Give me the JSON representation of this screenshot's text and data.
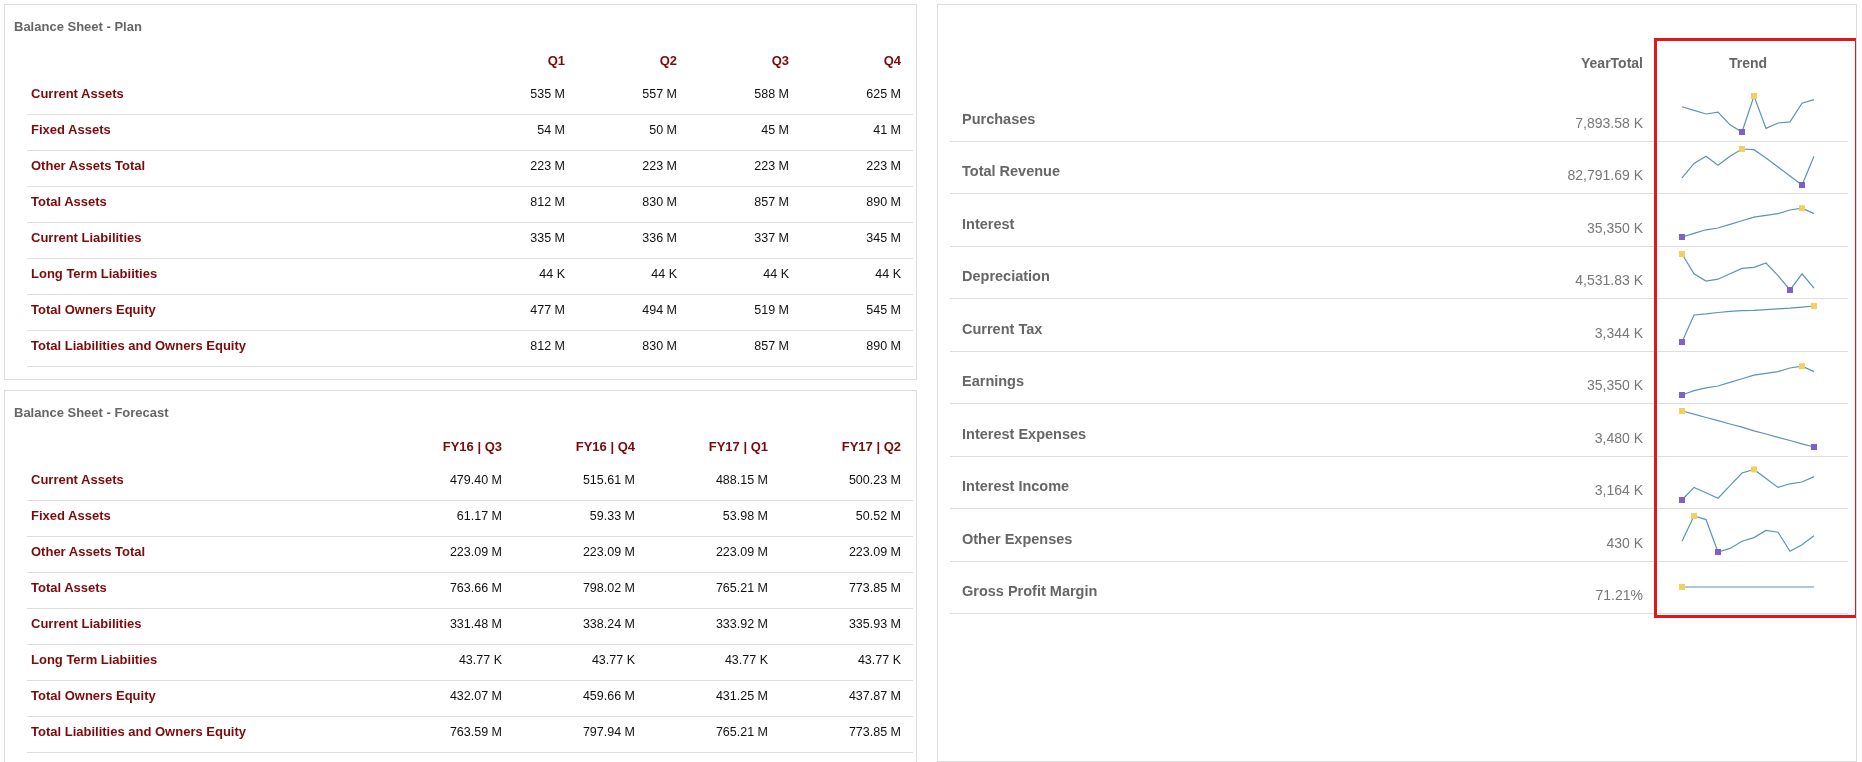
{
  "balance_sheets": [
    {
      "title": "Balance Sheet - Plan",
      "columns": [
        "Q1",
        "Q2",
        "Q3",
        "Q4"
      ],
      "rows": [
        {
          "label": "Current Assets",
          "values": [
            "535 M",
            "557 M",
            "588 M",
            "625 M"
          ]
        },
        {
          "label": "Fixed Assets",
          "values": [
            "54 M",
            "50 M",
            "45 M",
            "41 M"
          ]
        },
        {
          "label": "Other Assets Total",
          "values": [
            "223 M",
            "223 M",
            "223 M",
            "223 M"
          ]
        },
        {
          "label": "Total Assets",
          "values": [
            "812 M",
            "830 M",
            "857 M",
            "890 M"
          ]
        },
        {
          "label": "Current Liabilities",
          "values": [
            "335 M",
            "336 M",
            "337 M",
            "345 M"
          ]
        },
        {
          "label": "Long Term Liabiities",
          "values": [
            "44 K",
            "44 K",
            "44 K",
            "44 K"
          ]
        },
        {
          "label": "Total Owners Equity",
          "values": [
            "477 M",
            "494 M",
            "519 M",
            "545 M"
          ]
        },
        {
          "label": "Total Liabilities and Owners Equity",
          "values": [
            "812 M",
            "830 M",
            "857 M",
            "890 M"
          ]
        }
      ]
    },
    {
      "title": "Balance Sheet - Forecast",
      "columns": [
        "FY16 | Q3",
        "FY16 | Q4",
        "FY17 | Q1",
        "FY17 | Q2"
      ],
      "rows": [
        {
          "label": "Current Assets",
          "values": [
            "479.40 M",
            "515.61 M",
            "488.15 M",
            "500.23 M"
          ]
        },
        {
          "label": "Fixed Assets",
          "values": [
            "61.17 M",
            "59.33 M",
            "53.98 M",
            "50.52 M"
          ]
        },
        {
          "label": "Other Assets Total",
          "values": [
            "223.09 M",
            "223.09 M",
            "223.09 M",
            "223.09 M"
          ]
        },
        {
          "label": "Total Assets",
          "values": [
            "763.66 M",
            "798.02 M",
            "765.21 M",
            "773.85 M"
          ]
        },
        {
          "label": "Current Liabilities",
          "values": [
            "331.48 M",
            "338.24 M",
            "333.92 M",
            "335.93 M"
          ]
        },
        {
          "label": "Long Term Liabiities",
          "values": [
            "43.77 K",
            "43.77 K",
            "43.77 K",
            "43.77 K"
          ]
        },
        {
          "label": "Total Owners Equity",
          "values": [
            "432.07 M",
            "459.66 M",
            "431.25 M",
            "437.87 M"
          ]
        },
        {
          "label": "Total Liabilities and Owners Equity",
          "values": [
            "763.59 M",
            "797.94 M",
            "765.21 M",
            "773.85 M"
          ]
        }
      ]
    }
  ],
  "trend_table": {
    "columns": [
      "YearTotal",
      "Trend"
    ],
    "rows": [
      {
        "label": "Purchases",
        "year_total": "7,893.58 K"
      },
      {
        "label": "Total Revenue",
        "year_total": "82,791.69 K"
      },
      {
        "label": "Interest",
        "year_total": "35,350 K"
      },
      {
        "label": "Depreciation",
        "year_total": "4,531.83 K"
      },
      {
        "label": "Current Tax",
        "year_total": "3,344 K"
      },
      {
        "label": "Earnings",
        "year_total": "35,350 K"
      },
      {
        "label": "Interest Expenses",
        "year_total": "3,480 K"
      },
      {
        "label": "Interest Income",
        "year_total": "3,164 K"
      },
      {
        "label": "Other Expenses",
        "year_total": "430 K"
      },
      {
        "label": "Gross Profit Margin",
        "year_total": "71.21%"
      }
    ]
  }
}
